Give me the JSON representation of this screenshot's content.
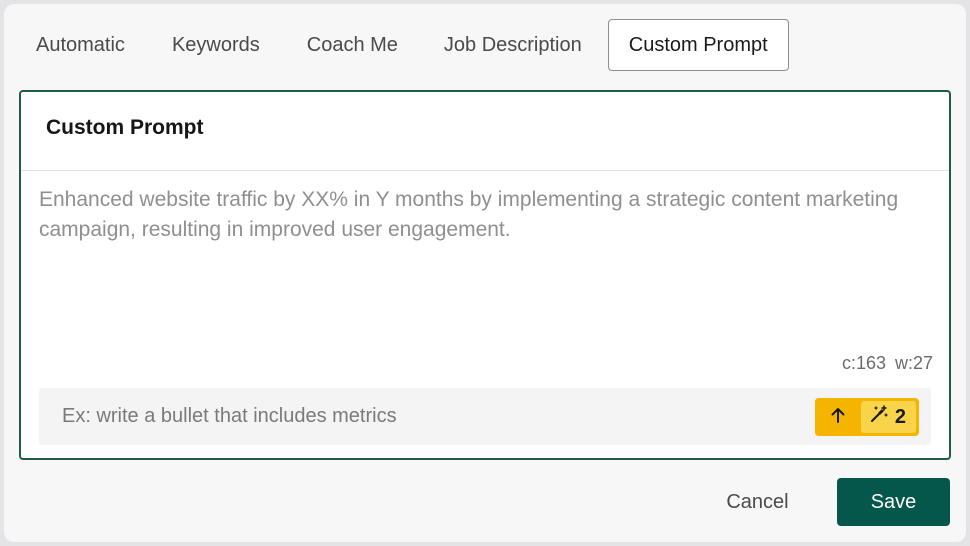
{
  "tabs": [
    {
      "label": "Automatic",
      "active": false
    },
    {
      "label": "Keywords",
      "active": false
    },
    {
      "label": "Coach Me",
      "active": false
    },
    {
      "label": "Job Description",
      "active": false
    },
    {
      "label": "Custom Prompt",
      "active": true
    }
  ],
  "panel": {
    "title": "Custom Prompt",
    "prompt_text": "Enhanced website traffic by XX% in Y months by implementing a strategic content marketing campaign, resulting in improved user engagement.",
    "counts": "c:163  w:27",
    "input": {
      "placeholder": "Ex: write a bullet that includes metrics",
      "value": ""
    },
    "actions": {
      "send_icon": "arrow-up-icon",
      "wand_icon": "magic-wand-icon",
      "credits": "2"
    }
  },
  "footer": {
    "cancel_label": "Cancel",
    "save_label": "Save"
  },
  "colors": {
    "accent": "#04574a",
    "panel_border": "#1f5c4b",
    "highlight": "#f4b400"
  }
}
